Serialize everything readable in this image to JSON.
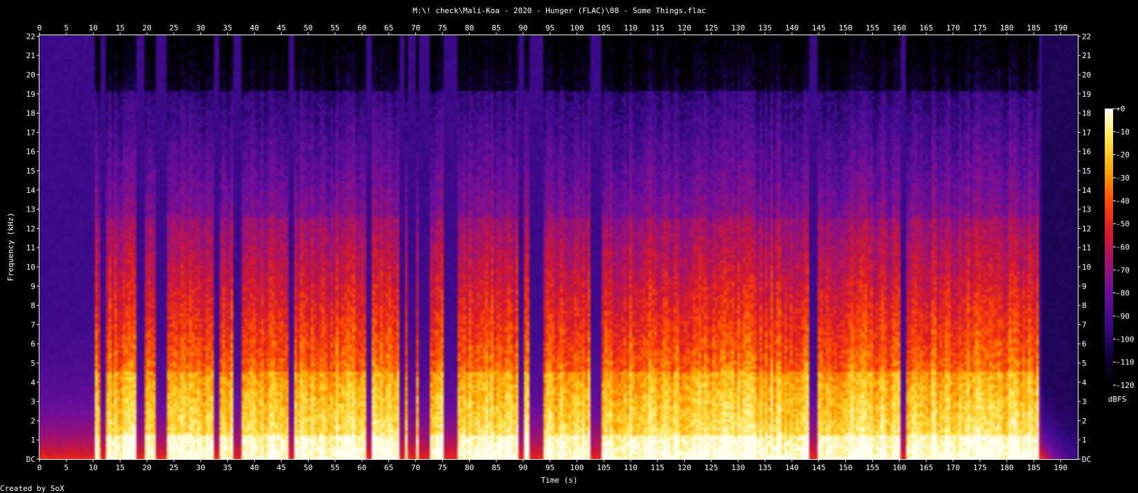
{
  "chart_data": {
    "type": "heatmap",
    "title": "M:\\! check\\Mali-Koa - 2020 - Hunger (FLAC)\\08 - Some Things.flac",
    "xlabel": "Time (s)",
    "ylabel": "Frequency (kHz)",
    "xlim": [
      0,
      193.2
    ],
    "ylim": [
      0,
      22.05
    ],
    "x_ticks": [
      "0",
      "5",
      "10",
      "15",
      "20",
      "25",
      "30",
      "35",
      "40",
      "45",
      "50",
      "55",
      "60",
      "65",
      "70",
      "75",
      "80",
      "85",
      "90",
      "95",
      "100",
      "105",
      "110",
      "115",
      "120",
      "125",
      "130",
      "135",
      "140",
      "145",
      "150",
      "155",
      "160",
      "165",
      "170",
      "175",
      "180",
      "185",
      "190"
    ],
    "y_ticks": [
      "DC",
      "1",
      "2",
      "3",
      "4",
      "5",
      "6",
      "7",
      "8",
      "9",
      "10",
      "11",
      "12",
      "13",
      "14",
      "15",
      "16",
      "17",
      "18",
      "19",
      "20",
      "21",
      "22"
    ],
    "colorbar": {
      "label": "dBFS",
      "range": [
        -120,
        0
      ],
      "ticks": [
        "+0",
        "-10",
        "-20",
        "-30",
        "-40",
        "-50",
        "-60",
        "-70",
        "-80",
        "-90",
        "-100",
        "-110",
        "-120"
      ],
      "colors": [
        "#000000",
        "#12033d",
        "#3a0a8a",
        "#6a0e9e",
        "#a0126e",
        "#d81a28",
        "#ff4a00",
        "#ffa800",
        "#ffe44a",
        "#ffffee"
      ]
    },
    "quiet_gaps_s": [
      [
        0,
        10.2
      ],
      [
        11.5,
        12.3
      ],
      [
        18.0,
        19.5
      ],
      [
        21.7,
        23.5
      ],
      [
        32.5,
        33.5
      ],
      [
        36.2,
        37.8
      ],
      [
        46.5,
        47.6
      ],
      [
        61.0,
        62.0
      ],
      [
        66.8,
        68.0
      ],
      [
        68.7,
        70.2
      ],
      [
        70.8,
        72.4
      ],
      [
        75.0,
        78.0
      ],
      [
        89.0,
        90.3
      ],
      [
        91.0,
        94.0
      ],
      [
        102.7,
        104.5
      ],
      [
        143.0,
        145.0
      ],
      [
        160.0,
        161.5
      ],
      [
        186.0,
        193.2
      ]
    ],
    "bandwidth_khz": 20.0,
    "content_end_s": 186.5
  },
  "footer": {
    "credit": "Created by SoX"
  }
}
